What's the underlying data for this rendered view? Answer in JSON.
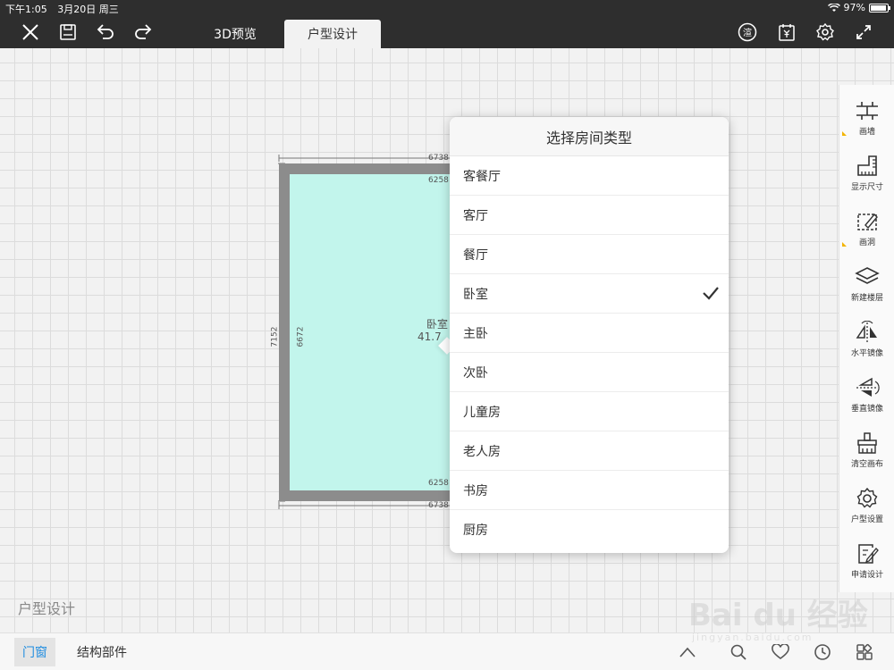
{
  "status": {
    "time": "下午1:05",
    "date": "3月20日 周三",
    "battery": "97%"
  },
  "tabs": [
    {
      "label": "3D预览"
    },
    {
      "label": "户型设计"
    }
  ],
  "room": {
    "label": "卧室",
    "area": "41.7",
    "dims": {
      "outer_top": "6738",
      "inner_top": "6258",
      "outer_left": "7152",
      "inner_left": "6672",
      "inner_bottom": "6258",
      "outer_bottom": "6738"
    }
  },
  "canvas_title": "户型设计",
  "popover": {
    "title": "选择房间类型",
    "items": [
      {
        "label": "客餐厅"
      },
      {
        "label": "客厅"
      },
      {
        "label": "餐厅"
      },
      {
        "label": "卧室",
        "selected": true
      },
      {
        "label": "主卧"
      },
      {
        "label": "次卧"
      },
      {
        "label": "儿童房"
      },
      {
        "label": "老人房"
      },
      {
        "label": "书房"
      },
      {
        "label": "厨房"
      }
    ]
  },
  "sidebar": [
    {
      "label": "画墙",
      "icon": "wall-draw-icon"
    },
    {
      "label": "显示尺寸",
      "icon": "ruler-icon"
    },
    {
      "label": "画洞",
      "icon": "hole-draw-icon"
    },
    {
      "label": "新建楼层",
      "icon": "layers-icon"
    },
    {
      "label": "水平镜像",
      "icon": "mirror-horizontal-icon"
    },
    {
      "label": "垂直镜像",
      "icon": "mirror-vertical-icon"
    },
    {
      "label": "清空画布",
      "icon": "brush-icon"
    },
    {
      "label": "户型设置",
      "icon": "gear-icon"
    },
    {
      "label": "申请设计",
      "icon": "edit-document-icon"
    }
  ],
  "bottom": {
    "tab_doors": "门窗",
    "tab_structure": "结构部件"
  },
  "watermark": {
    "text": "Bai du 经验",
    "sub": "jingyan.baidu.com"
  },
  "colors": {
    "accent": "#1e8ce0",
    "floor": "#c2f5ec",
    "wall": "#8c8c8c",
    "toolbar": "#2e2e2e"
  }
}
